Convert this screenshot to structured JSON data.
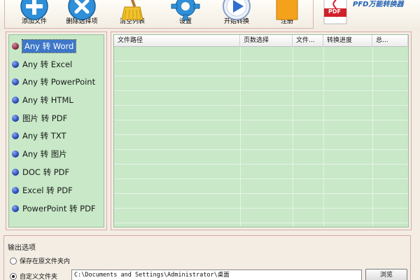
{
  "toolbar": {
    "buttons": [
      {
        "label": "添加文件",
        "icon": "add-icon"
      },
      {
        "label": "删除选择项",
        "icon": "delete-icon"
      },
      {
        "label": "清空列表",
        "icon": "broom-icon"
      },
      {
        "label": "设置",
        "icon": "gear-icon"
      },
      {
        "label": "开始转换",
        "icon": "play-icon"
      },
      {
        "label": "注册",
        "icon": "register-icon"
      }
    ],
    "logo_text": "PFD万能转换器",
    "logo_badge": "PDF"
  },
  "conversions": [
    {
      "label": "Any 转 Word",
      "selected": true
    },
    {
      "label": "Any 转 Excel"
    },
    {
      "label": "Any 转 PowerPoint"
    },
    {
      "label": "Any 转 HTML"
    },
    {
      "label": "图片 转 PDF"
    },
    {
      "label": "Any 转 TXT"
    },
    {
      "label": "Any 转 图片"
    },
    {
      "label": "DOC 转 PDF"
    },
    {
      "label": "Excel 转 PDF"
    },
    {
      "label": "PowerPoint 转 PDF"
    }
  ],
  "table": {
    "columns": [
      "文件路径",
      "页数选择",
      "文件...",
      "转换进度",
      "总..."
    ]
  },
  "output": {
    "title": "输出选项",
    "option_source": "保存在原文件夹内",
    "option_custom": "自定义文件夹",
    "selected": "custom",
    "path": "C:\\Documents and Settings\\Administrator\\桌面",
    "browse_label": "浏览"
  },
  "colors": {
    "list_bg": "#c8e8c8",
    "panel_border": "#d9a9a9",
    "selection": "#3d77c9",
    "logo_blue": "#1f5fb0"
  }
}
